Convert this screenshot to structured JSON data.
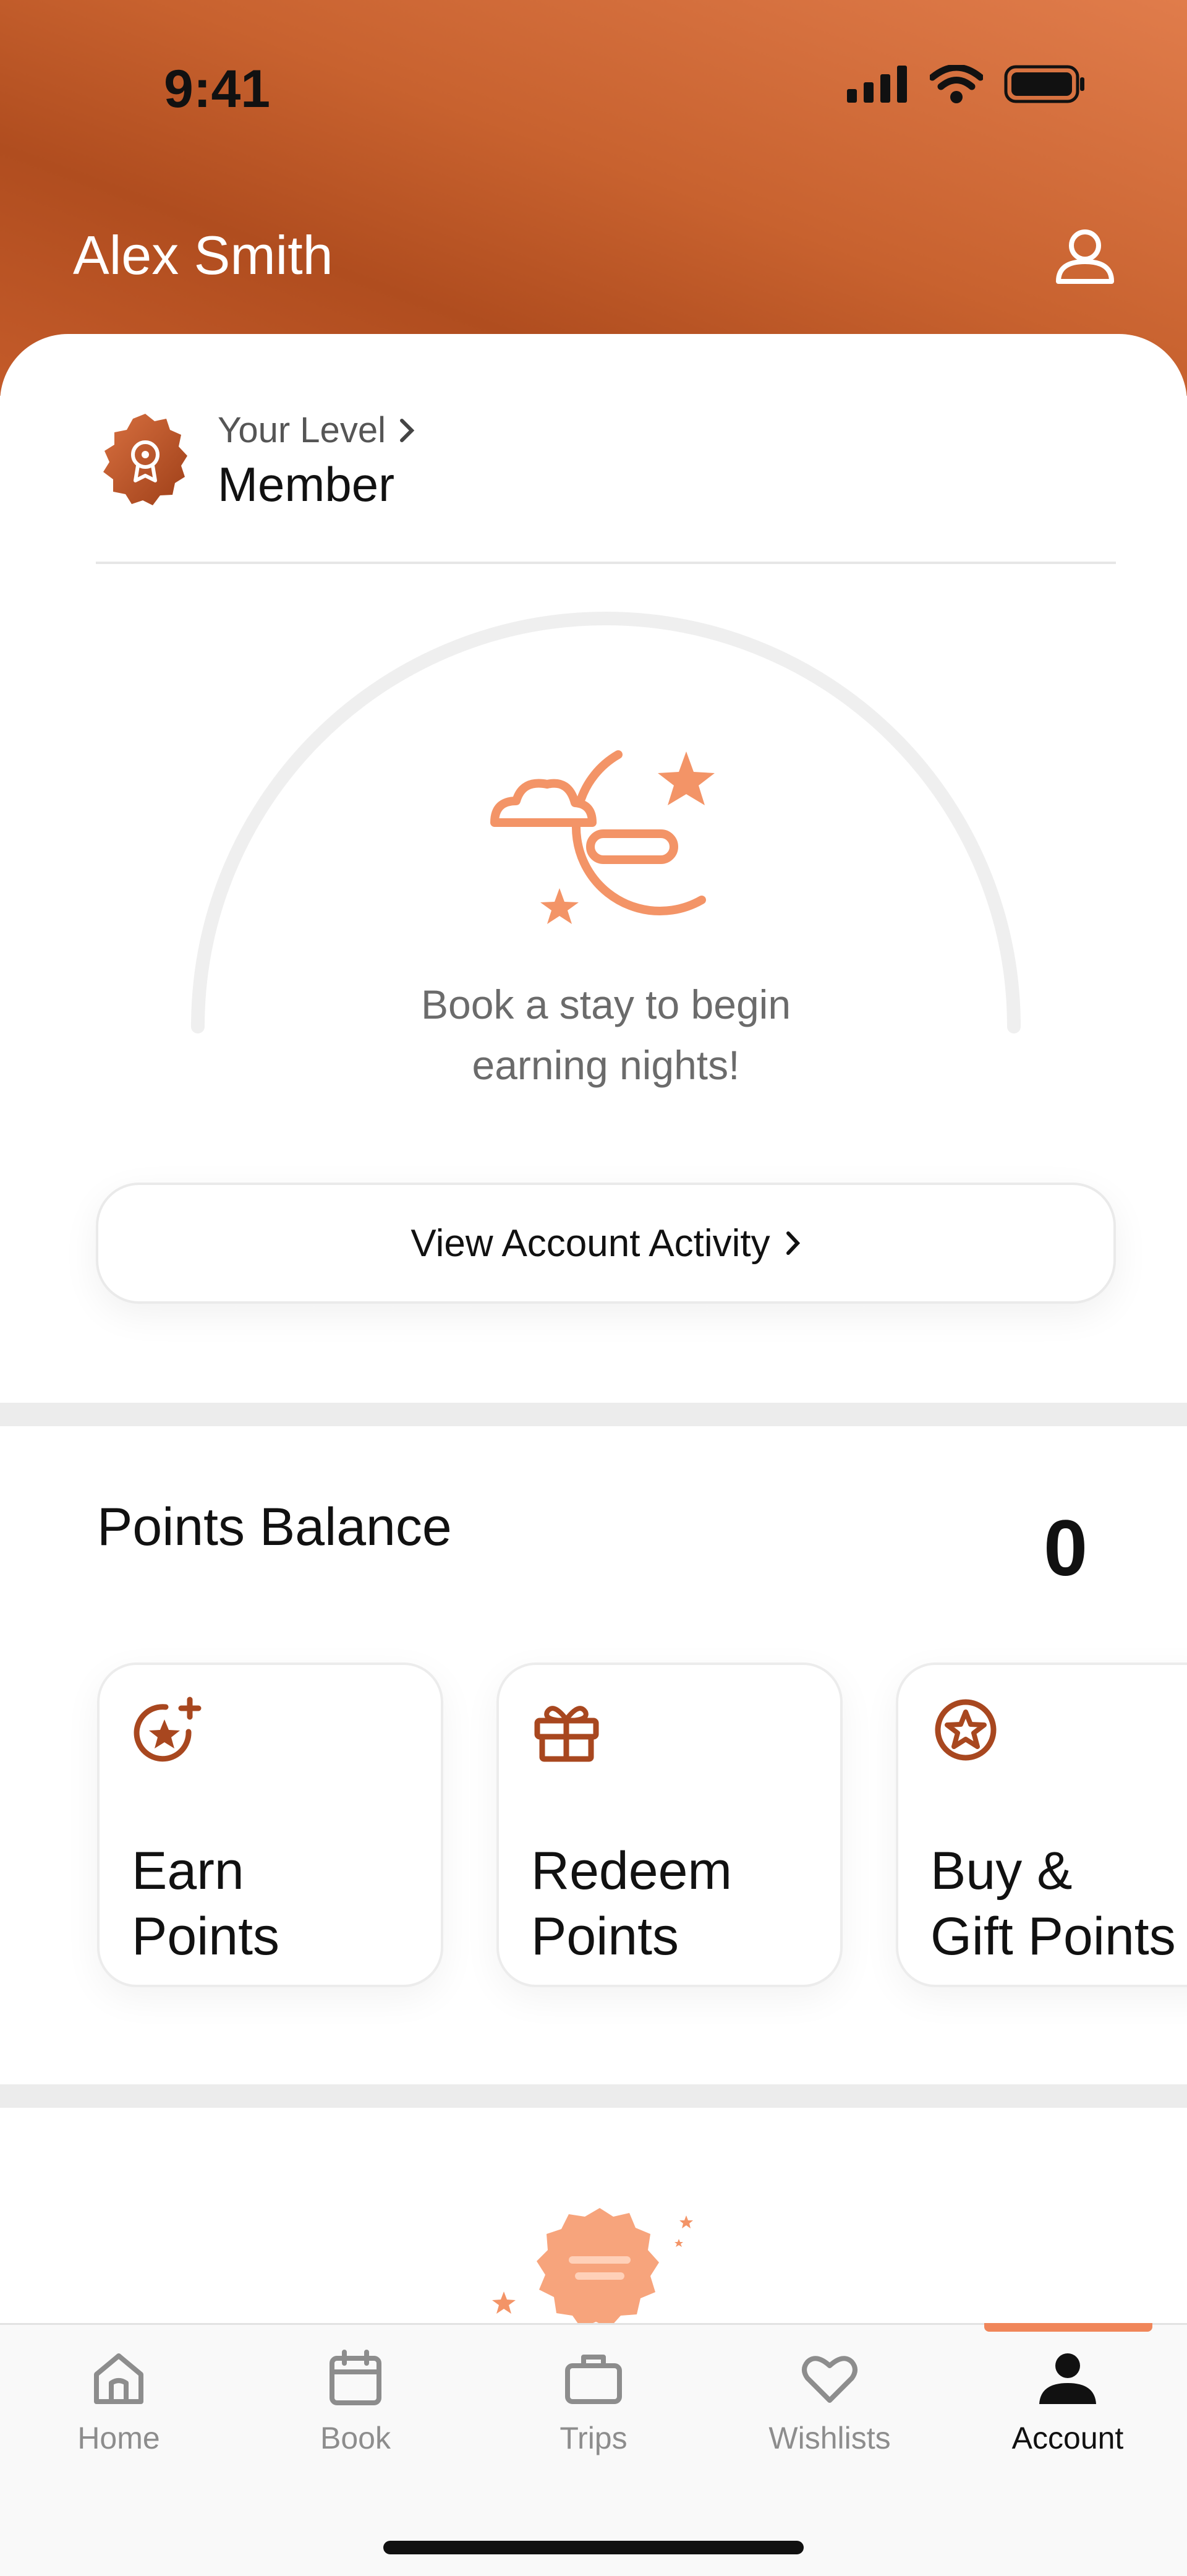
{
  "status_bar": {
    "time": "9:41"
  },
  "header": {
    "user_name": "Alex Smith"
  },
  "level": {
    "label": "Your Level",
    "name": "Member"
  },
  "progress": {
    "message_line1": "Book a stay to begin",
    "message_line2": "earning nights!"
  },
  "activity": {
    "button_label": "View Account Activity"
  },
  "points": {
    "title": "Points Balance",
    "value": "0",
    "tiles": [
      {
        "line1": "Earn",
        "line2": "Points",
        "icon": "star-plus-icon"
      },
      {
        "line1": "Redeem",
        "line2": "Points",
        "icon": "gift-icon"
      },
      {
        "line1": "Buy &",
        "line2": "Gift Points",
        "icon": "star-circle-icon"
      }
    ]
  },
  "tabs": [
    {
      "label": "Home",
      "icon": "home-icon"
    },
    {
      "label": "Book",
      "icon": "calendar-icon"
    },
    {
      "label": "Trips",
      "icon": "briefcase-icon"
    },
    {
      "label": "Wishlists",
      "icon": "heart-icon"
    },
    {
      "label": "Account",
      "icon": "person-icon",
      "active": true
    }
  ],
  "colors": {
    "accent": "#c8622f",
    "accent_light": "#f0865a",
    "icon_brown": "#a8471f"
  }
}
